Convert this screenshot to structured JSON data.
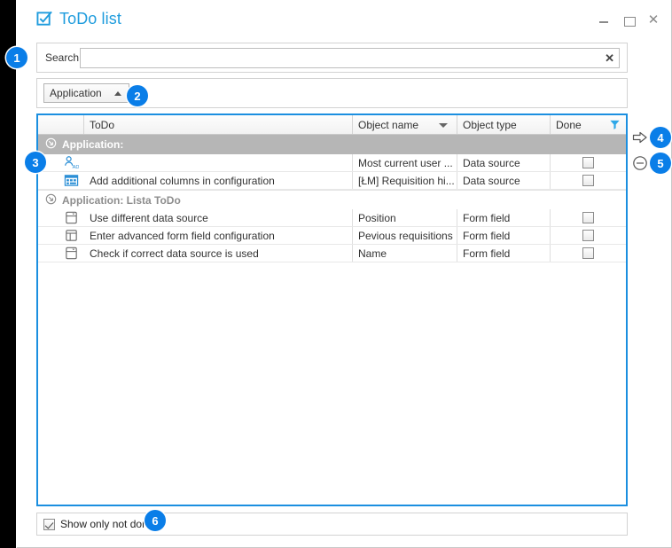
{
  "window": {
    "title": "ToDo list",
    "title_icon": "checkbox-check-icon",
    "controls": {
      "minimize": "–",
      "maximize": "▢",
      "close": "✕"
    }
  },
  "search": {
    "label": "Search",
    "value": "",
    "placeholder": "",
    "clear_label": "✕"
  },
  "groupby": {
    "chip_label": "Application",
    "sort_direction": "ascending"
  },
  "grid": {
    "columns": [
      {
        "key": "icon",
        "label": ""
      },
      {
        "key": "todo",
        "label": "ToDo"
      },
      {
        "key": "object_name",
        "label": "Object name",
        "sort": "descending"
      },
      {
        "key": "object_type",
        "label": "Object type"
      },
      {
        "key": "done",
        "label": "Done",
        "filter": true
      }
    ],
    "groups": [
      {
        "label": "Application:",
        "style": "selected",
        "rows": [
          {
            "icon": "user-ad-icon",
            "todo": "",
            "object_name": "Most current user ...",
            "object_type": "Data source",
            "done": false
          },
          {
            "icon": "data-source-icon",
            "todo": "Add additional columns in configuration",
            "object_name": "[ŁM] Requisition hi...",
            "object_type": "Data source",
            "done": false
          }
        ]
      },
      {
        "label": "Application: Lista ToDo",
        "style": "normal",
        "rows": [
          {
            "icon": "form-field-dropdown-icon",
            "todo": "Use different data source",
            "object_name": "Position",
            "object_type": "Form field",
            "done": false
          },
          {
            "icon": "form-field-panel-icon",
            "todo": "Enter advanced form field configuration",
            "object_name": "Pevious requisitions",
            "object_type": "Form field",
            "done": false
          },
          {
            "icon": "form-field-dropdown-icon",
            "todo": "Check if correct data source is used",
            "object_name": "Name",
            "object_type": "Form field",
            "done": false
          }
        ]
      }
    ]
  },
  "footer": {
    "show_only_not_done_label": "Show only not done",
    "show_only_not_done_checked": true
  },
  "side_actions": [
    {
      "name": "go-to-object",
      "icon": "right-arrow-icon"
    },
    {
      "name": "remove-todo",
      "icon": "minus-circle-icon"
    }
  ],
  "badges": [
    {
      "number": "1"
    },
    {
      "number": "2"
    },
    {
      "number": "3"
    },
    {
      "number": "4"
    },
    {
      "number": "5"
    },
    {
      "number": "6"
    }
  ],
  "colors": {
    "accent": "#1f9cdd",
    "badge": "#0a7ee8",
    "grid_border": "#1b8fe0",
    "group_selected_bg": "#b6b6b6"
  }
}
